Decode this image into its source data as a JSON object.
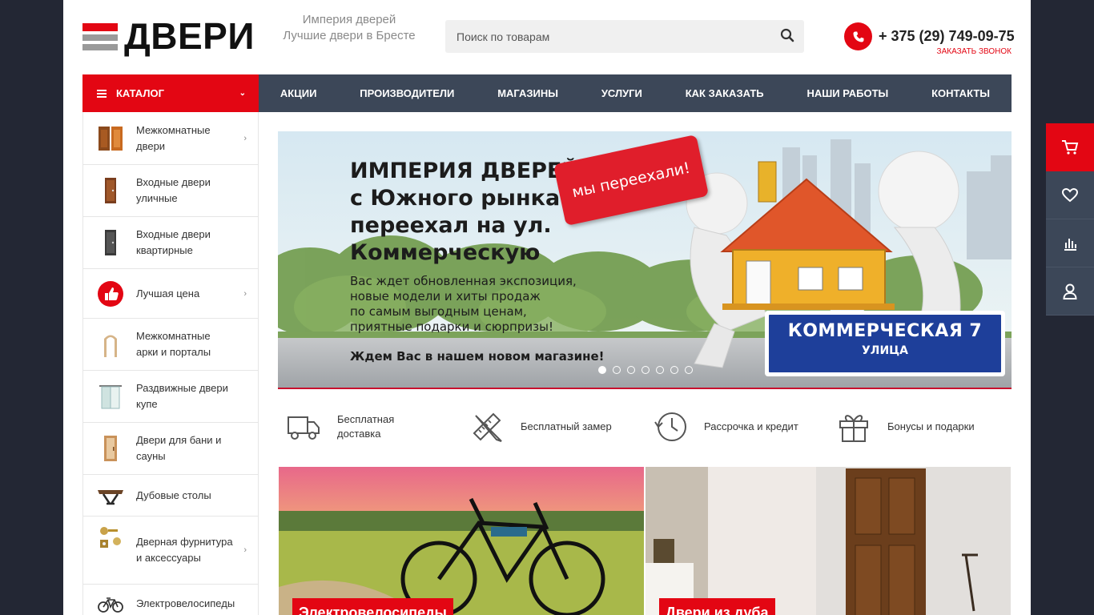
{
  "header": {
    "logo_text": "ДВЕРИ",
    "tagline_1": "Империя дверей",
    "tagline_2": "Лучшие двери в Бресте",
    "search_placeholder": "Поиск по товарам",
    "phone": "+ 375 (29) 749-09-75",
    "callback": "ЗАКАЗАТЬ ЗВОНОК"
  },
  "nav": {
    "catalog": "КАТАЛОГ",
    "items": [
      "АКЦИИ",
      "ПРОИЗВОДИТЕЛИ",
      "МАГАЗИНЫ",
      "УСЛУГИ",
      "КАК ЗАКАЗАТЬ",
      "НАШИ РАБОТЫ",
      "КОНТАКТЫ"
    ]
  },
  "sidebar": {
    "items": [
      {
        "label": "Межкомнатные двери",
        "icon": "interior-door-icon",
        "arrow": "›"
      },
      {
        "label": "Входные двери уличные",
        "icon": "entrance-door-icon"
      },
      {
        "label": "Входные двери квартирные",
        "icon": "apartment-door-icon"
      },
      {
        "label": "Лучшая цена",
        "icon": "thumbs-up-icon",
        "arrow": "›"
      },
      {
        "label": "Межкомнатные арки и порталы",
        "icon": "arch-icon"
      },
      {
        "label": "Раздвижные двери купе",
        "icon": "sliding-door-icon"
      },
      {
        "label": "Двери для бани и сауны",
        "icon": "sauna-door-icon"
      },
      {
        "label": "Дубовые столы",
        "icon": "table-icon"
      },
      {
        "label": "Дверная фурнитура и аксессуары",
        "icon": "hardware-icon",
        "arrow": "›"
      },
      {
        "label": "Электровелосипеды",
        "icon": "bicycle-icon"
      }
    ]
  },
  "banner": {
    "title": "ИМПЕРИЯ ДВЕРЕЙ\nс Южного рынка\nпереехал на ул.\nКоммерческую",
    "text": "Вас ждет обновленная экспозиция,\nновые модели и хиты продаж\nпо самым выгодным ценам,\nприятные подарки и сюрпризы!",
    "cta": "Ждем Вас в нашем новом магазине!",
    "stamp": "мы переехали!",
    "street_name": "КОММЕРЧЕСКАЯ 7",
    "street_sub": "УЛИЦА",
    "slides": 7,
    "active_slide": 1
  },
  "features": [
    {
      "label": "Бесплатная\nдоставка",
      "icon": "truck-icon"
    },
    {
      "label": "Бесплатный замер",
      "icon": "ruler-pencil-icon"
    },
    {
      "label": "Рассрочка и кредит",
      "icon": "clock-icon"
    },
    {
      "label": "Бонусы и подарки",
      "icon": "gift-icon"
    }
  ],
  "promos": [
    {
      "label": "Электровелосипеды",
      "image": "ebike-photo"
    },
    {
      "label": "Двери из дуба",
      "image": "oak-door-photo"
    }
  ],
  "right_panel": [
    "cart-icon",
    "heart-icon",
    "compare-icon",
    "user-icon"
  ],
  "colors": {
    "accent": "#e30613",
    "nav_bg": "#3c4758",
    "outer_bg": "#232734"
  }
}
